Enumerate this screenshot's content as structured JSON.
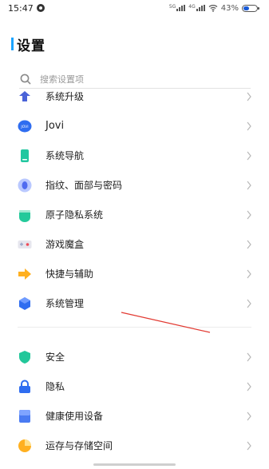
{
  "status_bar": {
    "time": "15:47",
    "network_left_label": "5G",
    "network_right_label": "4G",
    "battery_percent": "43%",
    "battery_level": 0.43
  },
  "page": {
    "title": "设置",
    "accent_color": "#1aa4ff"
  },
  "search": {
    "placeholder": "搜索设置项",
    "icon": "search-icon"
  },
  "settings": {
    "items": [
      {
        "label": "系统升级",
        "icon": "system-update-icon"
      },
      {
        "label": "Jovi",
        "icon": "jovi-icon"
      },
      {
        "label": "系统导航",
        "icon": "system-navigation-icon"
      },
      {
        "label": "指纹、面部与密码",
        "icon": "fingerprint-icon"
      },
      {
        "label": "原子隐私系统",
        "icon": "atomic-privacy-icon"
      },
      {
        "label": "游戏魔盒",
        "icon": "game-box-icon"
      },
      {
        "label": "快捷与辅助",
        "icon": "shortcut-arrow-icon"
      },
      {
        "label": "系统管理",
        "icon": "system-management-icon"
      }
    ],
    "items_second": [
      {
        "label": "安全",
        "icon": "security-shield-icon"
      },
      {
        "label": "隐私",
        "icon": "privacy-lock-icon"
      },
      {
        "label": "健康使用设备",
        "icon": "healthy-usage-icon"
      },
      {
        "label": "运存与存储空间",
        "icon": "storage-pie-icon"
      }
    ]
  }
}
